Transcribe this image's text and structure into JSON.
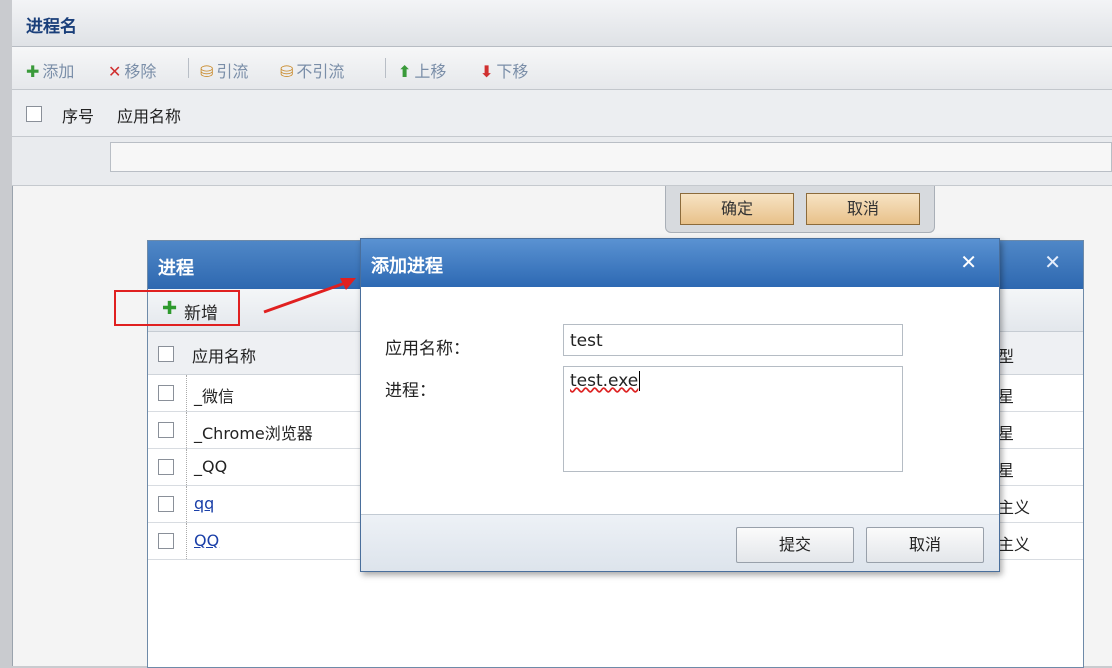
{
  "base": {
    "title": "进程名",
    "toolbar": {
      "add": "添加",
      "remove": "移除",
      "divert": "引流",
      "no_divert": "不引流",
      "move_up": "上移",
      "move_down": "下移"
    },
    "grid_headers": [
      "序号",
      "应用名称"
    ],
    "confirm_label": "确定",
    "cancel_label": "取消"
  },
  "process_dialog": {
    "title": "进程",
    "add_new": "新增",
    "header_name": "应用名称",
    "header_type_partial": "型",
    "rows": [
      {
        "name": "_微信",
        "type_partial": "星",
        "link": false
      },
      {
        "name": "_Chrome浏览器",
        "type_partial": "星",
        "link": false
      },
      {
        "name": "_QQ",
        "type_partial": "星",
        "link": false
      },
      {
        "name": "qq",
        "type_partial": "主义",
        "link": true
      },
      {
        "name": "QQ",
        "type_partial": "主义",
        "link": true
      }
    ]
  },
  "add_dialog": {
    "title": "添加进程",
    "name_label": "应用名称：",
    "name_value": "test",
    "process_label": "进程：",
    "process_value": "test.exe",
    "submit_label": "提交",
    "cancel_label": "取消"
  },
  "colors": {
    "title_bar": "#2e68b0",
    "highlight_box": "#e02020",
    "arrow": "#e02020"
  }
}
